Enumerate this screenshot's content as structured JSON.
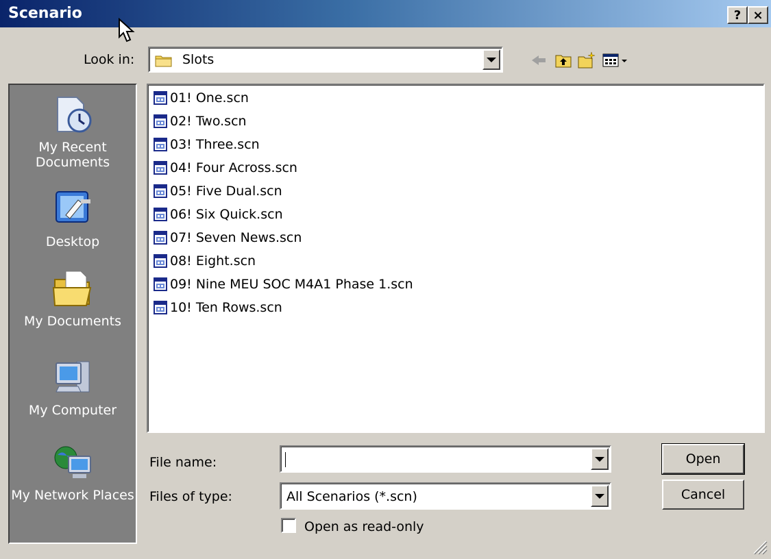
{
  "window": {
    "title": "Scenario",
    "help_label": "?",
    "close_label": "×"
  },
  "look_in": {
    "label": "Look in:",
    "value": "Slots"
  },
  "toolbar": {
    "icons": [
      "back-arrow-icon",
      "up-folder-icon",
      "new-folder-icon",
      "view-menu-icon"
    ]
  },
  "places": [
    {
      "label": "My Recent Documents",
      "icon": "recent-documents-icon"
    },
    {
      "label": "Desktop",
      "icon": "desktop-icon"
    },
    {
      "label": "My Documents",
      "icon": "my-documents-icon"
    },
    {
      "label": "My Computer",
      "icon": "my-computer-icon"
    },
    {
      "label": "My Network Places",
      "icon": "network-places-icon"
    }
  ],
  "files": [
    "01! One.scn",
    "02! Two.scn",
    "03! Three.scn",
    "04! Four Across.scn",
    "05! Five Dual.scn",
    "06! Six Quick.scn",
    "07! Seven News.scn",
    "08! Eight.scn",
    "09! Nine MEU SOC M4A1 Phase 1.scn",
    "10! Ten Rows.scn"
  ],
  "file_name": {
    "label": "File name:",
    "value": ""
  },
  "file_type": {
    "label": "Files of type:",
    "value": "All Scenarios (*.scn)"
  },
  "readonly": {
    "label": "Open as read-only",
    "checked": false
  },
  "buttons": {
    "open": "Open",
    "cancel": "Cancel"
  }
}
